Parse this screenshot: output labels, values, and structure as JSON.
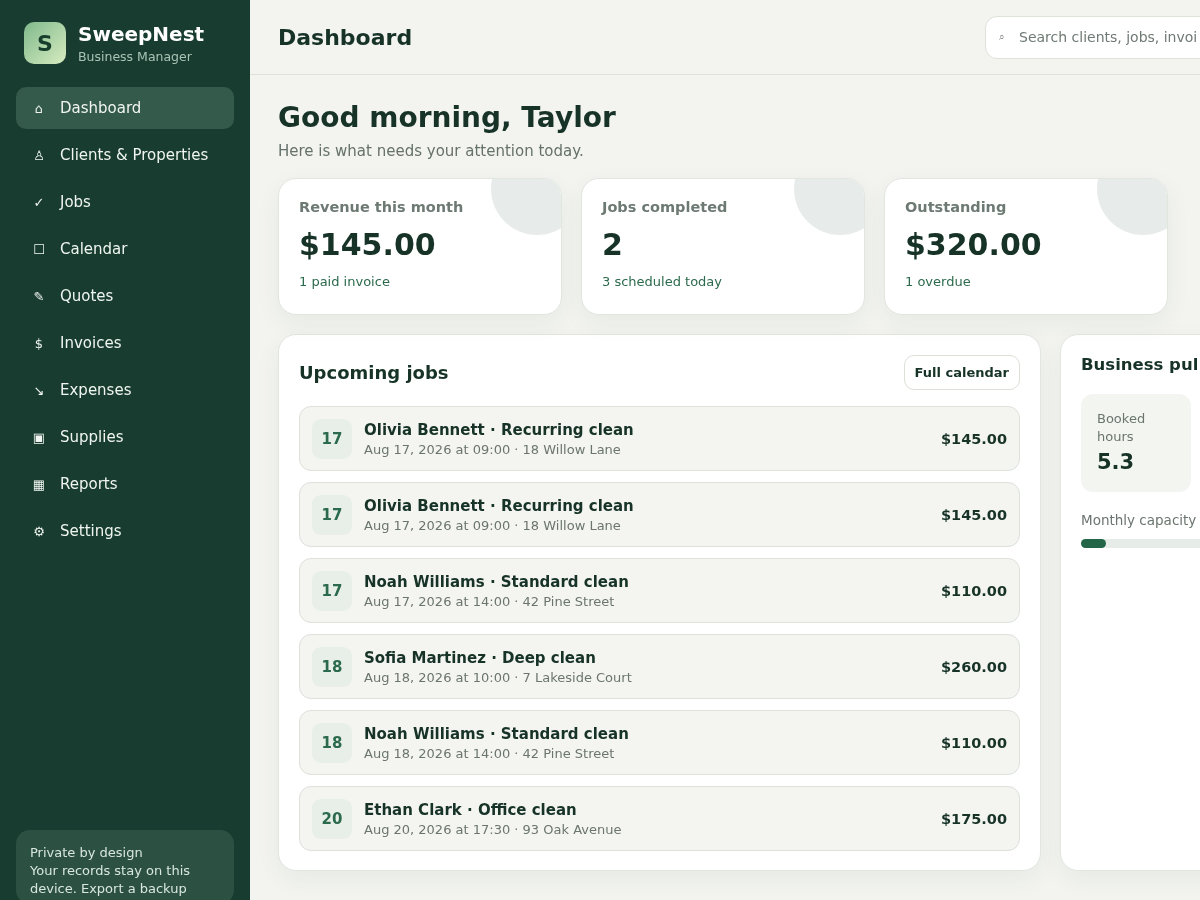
{
  "brand": {
    "logo": "S",
    "name": "SweepNest",
    "subtitle": "Business Manager"
  },
  "nav": [
    {
      "icon": "⌂",
      "label": "Dashboard",
      "selected": true
    },
    {
      "icon": "♙",
      "label": "Clients & Properties",
      "selected": false
    },
    {
      "icon": "✓",
      "label": "Jobs",
      "selected": false
    },
    {
      "icon": "☐",
      "label": "Calendar",
      "selected": false
    },
    {
      "icon": "✎",
      "label": "Quotes",
      "selected": false
    },
    {
      "icon": "$",
      "label": "Invoices",
      "selected": false
    },
    {
      "icon": "↘",
      "label": "Expenses",
      "selected": false
    },
    {
      "icon": "▣",
      "label": "Supplies",
      "selected": false
    },
    {
      "icon": "▦",
      "label": "Reports",
      "selected": false
    },
    {
      "icon": "⚙",
      "label": "Settings",
      "selected": false
    }
  ],
  "privacy_note": {
    "title": "Private by design",
    "text": "Your records stay on this device. Export a backup"
  },
  "header": {
    "title": "Dashboard",
    "search": {
      "icon": "⌕",
      "placeholder": "Search clients, jobs, invoi"
    }
  },
  "greeting": {
    "title": "Good morning, Taylor",
    "subtitle": "Here is what needs your attention today."
  },
  "stats": [
    {
      "label": "Revenue this month",
      "value": "$145.00",
      "note": "1 paid invoice"
    },
    {
      "label": "Jobs completed",
      "value": "2",
      "note": "3 scheduled today"
    },
    {
      "label": "Outstanding",
      "value": "$320.00",
      "note": "1 overdue"
    }
  ],
  "upcoming_jobs": {
    "title": "Upcoming jobs",
    "button": "Full calendar",
    "jobs": [
      {
        "day": "17",
        "title": "Olivia Bennett · Recurring clean",
        "details": "Aug 17, 2026 at 09:00 · 18 Willow Lane",
        "amount": "$145.00"
      },
      {
        "day": "17",
        "title": "Olivia Bennett · Recurring clean",
        "details": "Aug 17, 2026 at 09:00 · 18 Willow Lane",
        "amount": "$145.00"
      },
      {
        "day": "17",
        "title": "Noah Williams · Standard clean",
        "details": "Aug 17, 2026 at 14:00 · 42 Pine Street",
        "amount": "$110.00"
      },
      {
        "day": "18",
        "title": "Sofia Martinez · Deep clean",
        "details": "Aug 18, 2026 at 10:00 · 7 Lakeside Court",
        "amount": "$260.00"
      },
      {
        "day": "18",
        "title": "Noah Williams · Standard clean",
        "details": "Aug 18, 2026 at 14:00 · 42 Pine Street",
        "amount": "$110.00"
      },
      {
        "day": "20",
        "title": "Ethan Clark · Office clean",
        "details": "Aug 20, 2026 at 17:30 · 93 Oak Avenue",
        "amount": "$175.00"
      }
    ]
  },
  "business_pulse": {
    "title": "Business pul",
    "tiles": [
      {
        "label": "Booked hours",
        "value": "5.3"
      }
    ],
    "capacity": {
      "label": "Monthly capacity",
      "level": 0.07
    }
  }
}
